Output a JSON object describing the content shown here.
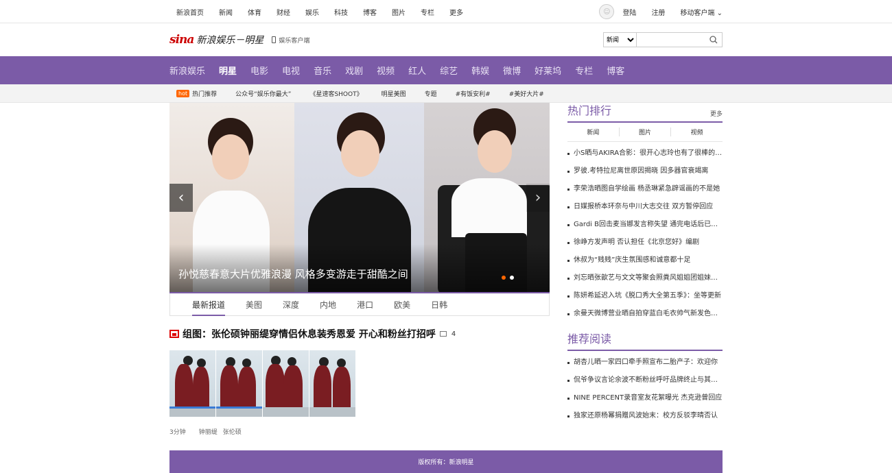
{
  "topbar": {
    "nav": [
      "新浪首页",
      "新闻",
      "体育",
      "财经",
      "娱乐",
      "科技",
      "博客",
      "图片",
      "专栏",
      "更多"
    ],
    "login": "登陆",
    "register": "注册",
    "mobile_client": "移动客户端 ⌄"
  },
  "header": {
    "logo_sina": "sina",
    "logo_name": "新浪娱乐－明星",
    "mobile_link": "娱乐客户端",
    "search_select": "新闻",
    "search_value": ""
  },
  "mainnav": [
    "新浪娱乐",
    "明星",
    "电影",
    "电视",
    "音乐",
    "戏剧",
    "视频",
    "红人",
    "综艺",
    "韩娱",
    "微博",
    "好莱坞",
    "专栏",
    "博客"
  ],
  "hotbar": {
    "badge": "hot",
    "items": [
      "热门推荐",
      "公众号“娱乐你最大”",
      "《星速客SHOOT》",
      "明星美图",
      "专题",
      "#有饭安利#",
      "#美好大片#"
    ]
  },
  "slider": {
    "caption": "孙悦慈春意大片优雅浪漫 风格多变游走于甜酷之间",
    "prev": "‹",
    "next": "›"
  },
  "tabs": [
    "最新报道",
    "美图",
    "深度",
    "内地",
    "港口",
    "欧美",
    "日韩"
  ],
  "article": {
    "title": "组图：张伦硕钟丽缇穿情侣休息装秀恩爱 开心和粉丝打招呼",
    "count": "4",
    "time": "3分钟",
    "tags": [
      "钟丽缇",
      "张伦硕"
    ]
  },
  "rank": {
    "title": "热门排行",
    "more": "更多",
    "tabs": [
      "新闻",
      "图片",
      "视频"
    ],
    "items": [
      "小S晒与AKIRA合影：很开心志玲也有了很棒的归宿",
      "罗彼.考特拉尼离世原因揭晓 因多器官衰竭离",
      "李荣浩晒图自学绘画 杨丞琳紧急辟谣画的不是她",
      "日媒报桥本环奈与中川大志交往 双方暂停回应",
      "Gardi B回击麦当娜发言称失望 通完电话后已和解",
      "徐峥方发声明 否认担任《北京您好》编剧",
      "休叔为“贱贱”庆生氛围感和诚意都十足",
      "刘忘晒张歆艺与文文等聚会照粪风姐姐团姐妹情深",
      "陈妍希延迟入坑《脱口秀大全第五季》：坐等更新",
      "余曼天微博营业晒自拍穿蓝白毛衣帅气新发色出镜"
    ]
  },
  "recommend": {
    "title": "推荐阅读",
    "items": [
      "胡杏儿晒一家四口牵手照宣布二胎产子：欢迎你",
      "侃爷争议言论余波不断粉丝呼吁品牌终止与其合作",
      "NINE PERCENT录音室友花絮曝光 杰克逊曾回应",
      "独家还原杨幂捐赠风波始末：校方反驳李晴否认"
    ]
  },
  "footer": {
    "copyright": "版权所有：新浪明星"
  },
  "colors": {
    "brand_purple": "#7b5ba7",
    "hot_orange": "#ff6600",
    "logo_red": "#cc0000"
  }
}
